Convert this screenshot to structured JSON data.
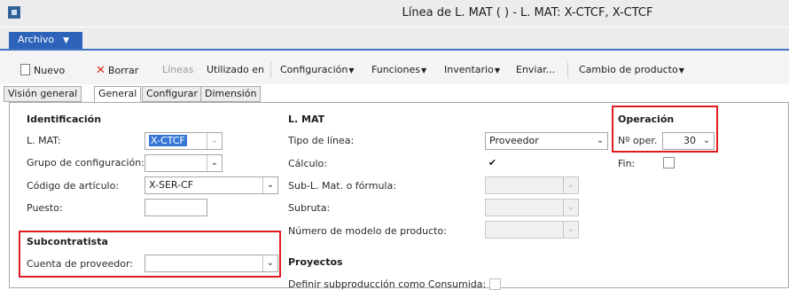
{
  "window": {
    "title": "Línea de L. MAT (          ) - L. MAT: X-CTCF, X-CTCF"
  },
  "menu": {
    "file_label": "Archivo"
  },
  "toolbar": {
    "nuevo": "Nuevo",
    "borrar": "Borrar",
    "lineas": "Líneas",
    "utilizado_en": "Utilizado en",
    "configuracion": "Configuración",
    "funciones": "Funciones",
    "inventario": "Inventario",
    "enviar": "Enviar...",
    "cambio_producto": "Cambio de producto"
  },
  "tabs": [
    "Visión general",
    "General",
    "Configurar",
    "Dimensión"
  ],
  "identificacion": {
    "heading": "Identificación",
    "lmat_label": "L. MAT:",
    "lmat_value": "X-CTCF",
    "grupo_label": "Grupo de configuración:",
    "grupo_value": "",
    "codigo_label": "Código de artículo:",
    "codigo_value": "X-SER-CF",
    "puesto_label": "Puesto:",
    "puesto_value": ""
  },
  "subcontratista": {
    "heading": "Subcontratista",
    "cuenta_label": "Cuenta de proveedor:",
    "cuenta_value": ""
  },
  "lmat": {
    "heading": "L. MAT",
    "tipo_label": "Tipo de línea:",
    "tipo_value": "Proveedor",
    "calculo_label": "Cálculo:",
    "calculo_checked": true,
    "sublmat_label": "Sub-L. Mat. o fórmula:",
    "subruta_label": "Subruta:",
    "modelo_label": "Número de modelo de producto:"
  },
  "proyectos": {
    "heading": "Proyectos",
    "definir_label": "Definir subproducción como Consumida:"
  },
  "operacion": {
    "heading": "Operación",
    "nooper_label": "Nº oper.",
    "nooper_value": "30",
    "fin_label": "Fin:",
    "fin_checked": false
  },
  "colors": {
    "accent": "#2d63b8",
    "highlight": "#e11b22",
    "selection": "#3778d6"
  }
}
